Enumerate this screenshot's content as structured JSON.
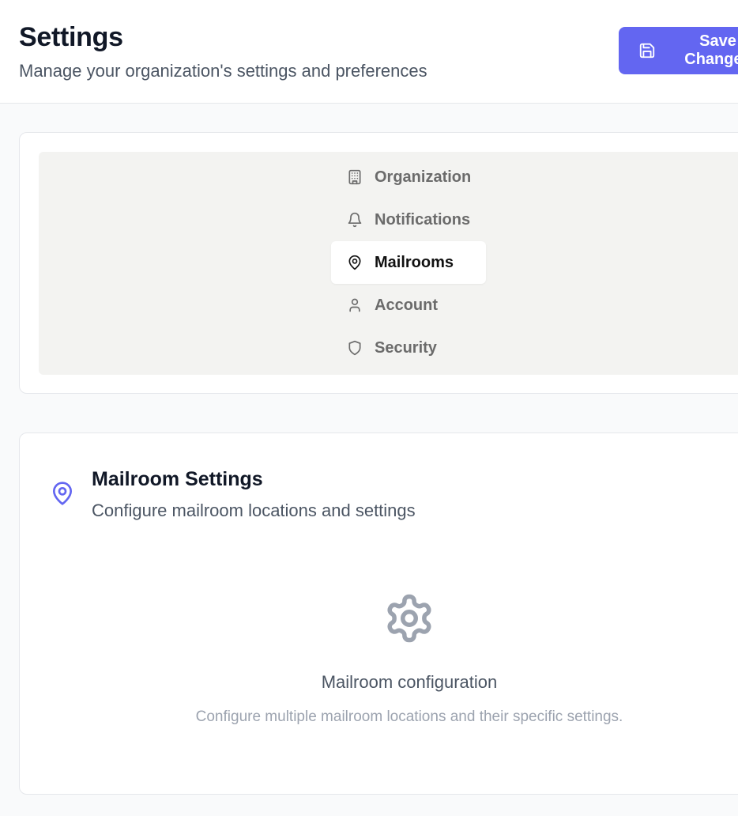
{
  "header": {
    "title": "Settings",
    "subtitle": "Manage your organization's settings and preferences",
    "save_label": "Save Changes",
    "save_icon": "save-icon"
  },
  "tabs": [
    {
      "label": "Organization",
      "icon": "building-icon",
      "active": false
    },
    {
      "label": "Notifications",
      "icon": "bell-icon",
      "active": false
    },
    {
      "label": "Mailrooms",
      "icon": "map-pin-icon",
      "active": true
    },
    {
      "label": "Account",
      "icon": "user-icon",
      "active": false
    },
    {
      "label": "Security",
      "icon": "shield-icon",
      "active": false
    }
  ],
  "section": {
    "title": "Mailroom Settings",
    "subtitle": "Configure mailroom locations and settings",
    "icon": "map-pin-icon"
  },
  "empty_state": {
    "icon": "gear-icon",
    "title": "Mailroom configuration",
    "description": "Configure multiple mailroom locations and their specific settings."
  },
  "colors": {
    "accent": "#6366f1",
    "tabs_background": "#f3f3f1",
    "page_background": "#f9fafb"
  }
}
